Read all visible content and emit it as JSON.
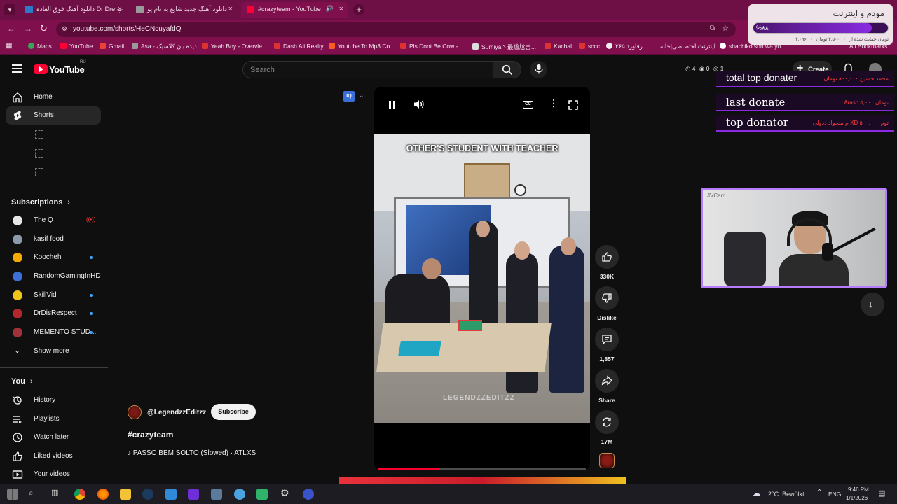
{
  "browser": {
    "tabs": [
      {
        "label": "دانلود آهنگ فوق العاده Dr Dre ب"
      },
      {
        "label": "دانلود آهنگ جدید شایع به نام پو"
      },
      {
        "label": "#crazyteam - YouTube"
      }
    ],
    "url": "youtube.com/shorts/HeCNcuyafdQ",
    "bookmarks": [
      "Maps",
      "YouTube",
      "Gmail",
      "Asa - دیده بان کلاسیک",
      "Yeah Boy - Overvie...",
      "Dash Ali Realty",
      "Youtube To Mp3 Co...",
      "Pls Dont Be Cow -...",
      "Sumiya丶最尴尬言...",
      "Kachal",
      "sccc",
      "رفاورد ۳۶۵",
      "اینترنت اختصاصی|خانه...",
      "shachiko son wa yo...",
      "All Bookmarks"
    ]
  },
  "masthead": {
    "logo": "YouTube",
    "region": "RU",
    "search_placeholder": "Search",
    "stats": [
      "4",
      "0",
      "1"
    ],
    "create_label": "Create"
  },
  "sidebar": {
    "main": [
      {
        "label": "Home",
        "icon": "home-icon"
      },
      {
        "label": "Shorts",
        "icon": "shorts-icon"
      }
    ],
    "subscriptions_title": "Subscriptions",
    "subscriptions": [
      {
        "name": "The Q",
        "color": "#e6e6e6",
        "status": "live"
      },
      {
        "name": "kasif food",
        "color": "#8a9aa8",
        "status": "none"
      },
      {
        "name": "Koocheh",
        "color": "#f2a900",
        "status": "new"
      },
      {
        "name": "RandomGamingInHD",
        "color": "#3d6fd8",
        "status": "none"
      },
      {
        "name": "SkillVid",
        "color": "#f0c419",
        "status": "new"
      },
      {
        "name": "DrDisRespect",
        "color": "#b3262b",
        "status": "new"
      },
      {
        "name": "MEMENTO STUD...",
        "color": "#a0303a",
        "status": "new"
      }
    ],
    "show_more": "Show more",
    "you_title": "You",
    "you": [
      {
        "label": "History",
        "icon": "history-icon"
      },
      {
        "label": "Playlists",
        "icon": "playlists-icon"
      },
      {
        "label": "Watch later",
        "icon": "watch-later-icon"
      },
      {
        "label": "Liked videos",
        "icon": "liked-icon"
      },
      {
        "label": "Your videos",
        "icon": "your-videos-icon"
      }
    ]
  },
  "short": {
    "caption": "OTHER'S STUDENT WITH TEACHER",
    "watermark": "LEGENDZZEDITZZ",
    "channel": "@LegendzzEditzz",
    "subscribe": "Subscribe",
    "title": "#crazyteam",
    "music": "PASSO BEM SOLTO (Slowed) · ATLXS",
    "progress": 0.29,
    "actions": {
      "likes": "330K",
      "dislike": "Dislike",
      "comments": "1,857",
      "share": "Share",
      "remix": "17M"
    }
  },
  "overlay": {
    "modem_title": "مودم و اینترنت",
    "modem_percent": "%۸۸",
    "modem_sub": "۳,۰۹۶,۰۰۰ تومان حمایت شده از ۳,۵۰۰,۰۰۰ تومان",
    "donations": [
      {
        "title": "total top donater",
        "value": "محمد حسین ۸۰۰,۰۰۰ تومان"
      },
      {
        "title": "last donate",
        "value": "Arash ۵,۰۰۰ تومان"
      },
      {
        "title": "top donator",
        "value": "م میخواد ددولی XD ۵۰۰,۰۰۰ توم"
      }
    ],
    "webcam_label": "JVCam"
  },
  "taskbar": {
    "weather": "2°C  Bewölkt",
    "lang": "ENG",
    "time": "9:46 PM",
    "date": "1/1/2026"
  },
  "colors": {
    "chrome": "#800f4e",
    "youtube_red": "#ff0033",
    "accent_purple": "#8a2be2"
  }
}
